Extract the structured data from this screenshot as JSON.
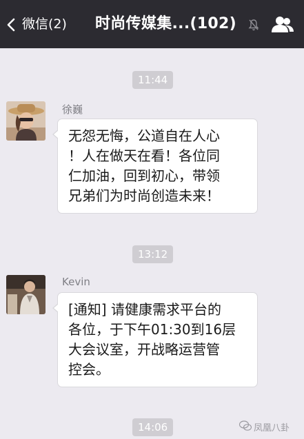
{
  "header": {
    "back_label": "微信(2)",
    "title": "时尚传媒集...(102)",
    "icons": [
      "back-chevron-icon",
      "mute-bell-icon",
      "group-profile-icon"
    ],
    "bar_color": "#2c2b31"
  },
  "messages": [
    {
      "time": "11:44",
      "sender": "徐巍",
      "lines": [
        "无怨无悔，公道自在人心",
        "！人在做天在看！各位同",
        "仁加油，回到初心，带领",
        "兄弟们为时尚创造未来！"
      ]
    },
    {
      "time": "13:12",
      "sender": "Kevin",
      "lines": [
        "[通知] 请健康需求平台的",
        "各位，于下午01:30到16层",
        "大会议室，开战略运营管",
        "控会。"
      ]
    }
  ],
  "footer": {
    "time": "14:06",
    "watermark": "凤凰八卦"
  },
  "colors": {
    "background": "#eceaf0",
    "bubble": "#ffffff",
    "timestamp_chip": "#cfcdd2"
  }
}
